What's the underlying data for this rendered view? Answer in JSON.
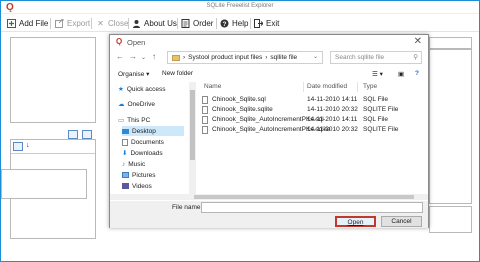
{
  "app": {
    "title": "SQLite Freeelist Explorer"
  },
  "toolbar": {
    "add_file": "Add File",
    "export": "Export",
    "close": "Close",
    "about_us": "About Us",
    "order": "Order",
    "help": "Help",
    "exit": "Exit"
  },
  "dialog": {
    "title": "Open",
    "address": {
      "items": [
        "Systool product input files",
        "sqllite file"
      ]
    },
    "search_placeholder": "Search sqllite file",
    "commands": {
      "organise": "Organise",
      "new_folder": "New folder"
    },
    "nav_items": [
      "Quick access",
      "OneDrive",
      "This PC",
      "Desktop",
      "Documents",
      "Downloads",
      "Music",
      "Pictures",
      "Videos"
    ],
    "columns": {
      "name": "Name",
      "date_modified": "Date modified",
      "type": "Type"
    },
    "files": [
      {
        "name": "Chinook_Sqlite.sql",
        "date": "14-11-2010 14:11",
        "type": "SQL File"
      },
      {
        "name": "Chinook_Sqlite.sqlite",
        "date": "14-11-2010 20:32",
        "type": "SQLITE File"
      },
      {
        "name": "Chinook_Sqlite_AutoIncrementPKs.sql",
        "date": "14-11-2010 14:11",
        "type": "SQL File"
      },
      {
        "name": "Chinook_Sqlite_AutoIncrementPKs.sqlite",
        "date": "14-11-2010 20:32",
        "type": "SQLITE File"
      }
    ],
    "file_name_label": "File name:",
    "file_name_value": "",
    "open_label": "Open",
    "cancel_label": "Cancel"
  },
  "colors": {
    "frame_blue": "#1a8fd6",
    "open_highlight": "#c0392b",
    "nav_selected": "#cde8fb"
  }
}
